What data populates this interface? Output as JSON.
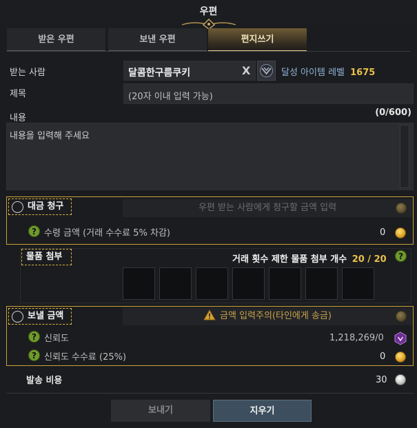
{
  "window": {
    "title": "우편"
  },
  "tabs": [
    {
      "label": "받은 우편",
      "active": false
    },
    {
      "label": "보낸 우편",
      "active": false
    },
    {
      "label": "편지쓰기",
      "active": true
    }
  ],
  "recipient": {
    "label": "받는 사람",
    "value": "달콤한구름쿠키",
    "clear_icon": "X",
    "achievement_label": "달성 아이템 레벨",
    "achievement_value": "1675"
  },
  "subject": {
    "label": "제목",
    "placeholder": "(20자 이내 입력 가능)"
  },
  "content": {
    "label": "내용",
    "counter": "(0/600)",
    "placeholder": "내용을 입력해 주세요"
  },
  "cod": {
    "label": "대금 청구",
    "input_placeholder": "우편 받는 사람에게 청구할 금액 입력",
    "fee_label": "수령 금액 (거래 수수료 5% 차감)",
    "fee_value": "0"
  },
  "attachments": {
    "label": "물품 첨부",
    "limit_label": "거래 횟수 제한 물품 첨부 개수",
    "limit_value": "20 / 20",
    "slot_count": 7
  },
  "send_gold": {
    "label": "보낼 금액",
    "warning": "금액 입력주의(타인에게 송금)",
    "trust_label": "신뢰도",
    "trust_value": "1,218,269/0",
    "trust_fee_label": "신뢰도 수수료 (25%)",
    "trust_fee_value": "0"
  },
  "shipping": {
    "label": "발송 비용",
    "value": "30"
  },
  "buttons": {
    "send": "보내기",
    "clear": "지우기"
  },
  "colors": {
    "accent_gold": "#e8c04c",
    "frame_gold": "#c9a23a",
    "help_green": "#6f9a2c"
  }
}
